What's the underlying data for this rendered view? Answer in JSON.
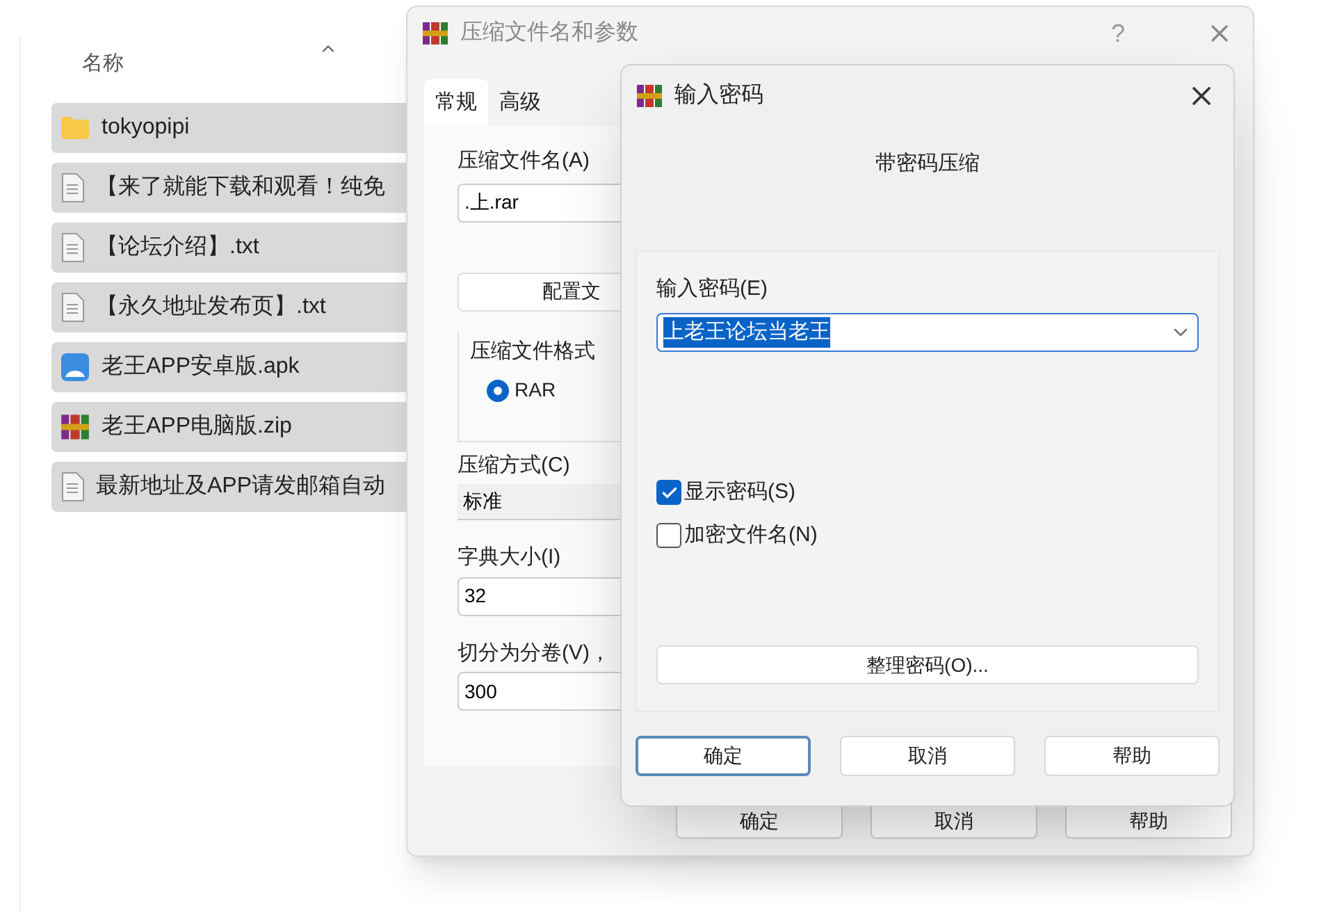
{
  "explorer": {
    "column_header": "名称",
    "files": [
      {
        "name": "tokyopipi",
        "kind": "folder",
        "selected": true
      },
      {
        "name": "【来了就能下载和观看！纯免",
        "kind": "text",
        "selected": true
      },
      {
        "name": "【论坛介绍】.txt",
        "kind": "text",
        "selected": true
      },
      {
        "name": "【永久地址发布页】.txt",
        "kind": "text",
        "selected": true
      },
      {
        "name": "老王APP安卓版.apk",
        "kind": "apk",
        "selected": true
      },
      {
        "name": "老王APP电脑版.zip",
        "kind": "archive",
        "selected": true
      },
      {
        "name": "最新地址及APP请发邮箱自动",
        "kind": "text",
        "selected": true
      }
    ]
  },
  "compress_dialog": {
    "title": "压缩文件名和参数",
    "help": "?",
    "tabs": [
      {
        "label": "常规",
        "selected": true
      },
      {
        "label": "高级",
        "selected": false
      }
    ],
    "archive_name_label": "压缩文件名(A)",
    "archive_name": ".上.rar",
    "profiles_button": "配置文",
    "format_group": "压缩文件格式",
    "format_options": [
      {
        "label": "RAR",
        "selected": true
      }
    ],
    "method_label": "压缩方式(C)",
    "method": "标准",
    "dictionary_label": "字典大小(I)",
    "dictionary": "32",
    "split_label": "切分为分卷(V)，",
    "split": "300",
    "buttons": [
      "确定",
      "取消",
      "帮助"
    ]
  },
  "password_dialog": {
    "title": "输入密码",
    "heading": "带密码压缩",
    "password_label": "输入密码(E)",
    "password": "上老王论坛当老王",
    "text_selected": true,
    "options": [
      {
        "label": "显示密码(S)",
        "checked": true
      },
      {
        "label": "加密文件名(N)",
        "checked": false
      }
    ],
    "organize_button": "整理密码(O)...",
    "buttons": [
      {
        "label": "确定",
        "default": true
      },
      {
        "label": "取消",
        "default": false
      },
      {
        "label": "帮助",
        "default": false
      }
    ]
  }
}
